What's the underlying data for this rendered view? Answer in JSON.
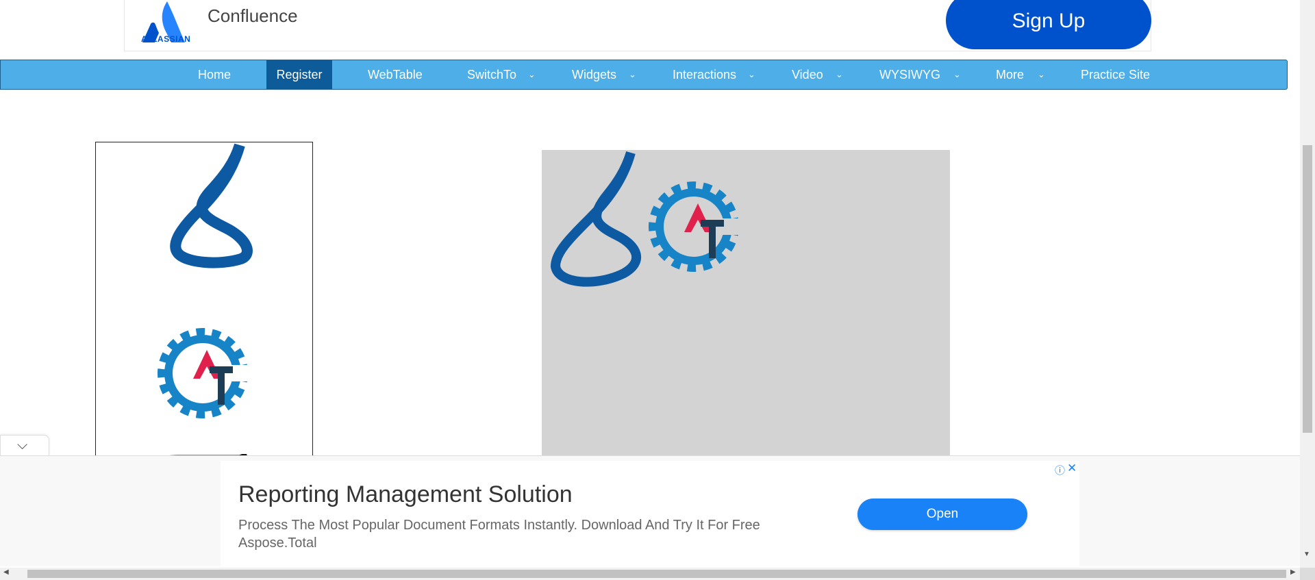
{
  "top_ad": {
    "brand": "ATLASSIAN",
    "product": "Confluence",
    "cta": "Sign Up"
  },
  "nav": {
    "items": [
      {
        "label": "Home",
        "dropdown": false
      },
      {
        "label": "Register",
        "dropdown": false,
        "active": true
      },
      {
        "label": "WebTable",
        "dropdown": false
      },
      {
        "label": "SwitchTo",
        "dropdown": true
      },
      {
        "label": "Widgets",
        "dropdown": true
      },
      {
        "label": "Interactions",
        "dropdown": true
      },
      {
        "label": "Video",
        "dropdown": true
      },
      {
        "label": "WYSIWYG",
        "dropdown": true
      },
      {
        "label": "More",
        "dropdown": true
      },
      {
        "label": "Practice Site",
        "dropdown": false
      }
    ],
    "chevron": "⌄"
  },
  "bottom_ad": {
    "toggle_icon": "chevron-down",
    "title": "Reporting Management Solution",
    "description": "Process The Most Popular Document Formats Instantly. Download And Try It For Free",
    "brand": "Aspose.Total",
    "cta": "Open",
    "info_icon": "ⓘ",
    "close_icon": "✕"
  },
  "colors": {
    "nav_bg": "#4eaee8",
    "nav_active": "#0d5b98",
    "atlassian_blue": "#0052cc",
    "drop_area": "#d3d3d3",
    "logo_s_blue": "#0d5aa3",
    "gear_blue": "#1784c7",
    "a_red": "#e0214c",
    "t_navy": "#1d3c55"
  }
}
